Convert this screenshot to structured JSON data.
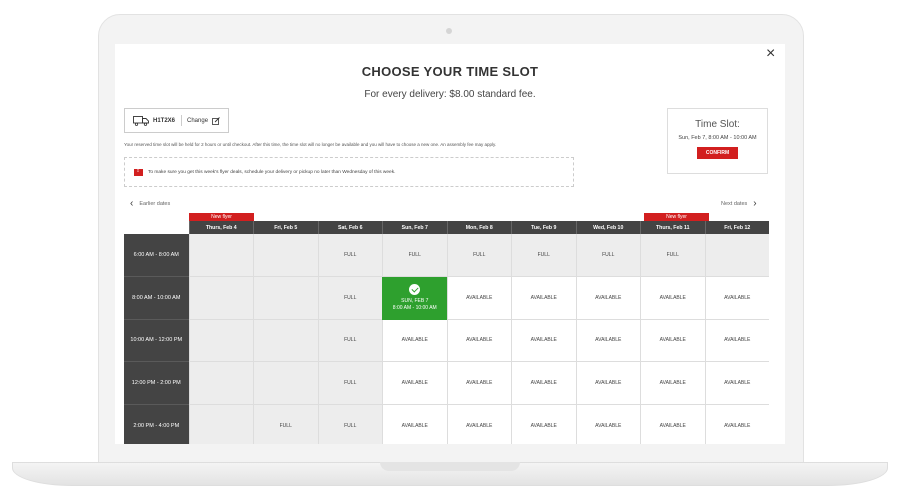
{
  "modal": {
    "close_label": "×",
    "title": "CHOOSE YOUR TIME SLOT",
    "subtitle": "For every delivery: $8.00 standard fee."
  },
  "postal": {
    "code": "H1T2X6",
    "change_label": "Change",
    "icon": "truck-icon"
  },
  "info_text": "Your reserved time slot will be held for 2 hours or until checkout. After this time, the time slot will no longer be available and you will have to choose a new one. An assembly fee may apply.",
  "flyer_notice": "To make sure you get this week's flyer deals, schedule your delivery or pickup no later than Wednesday of this week.",
  "timeslot_card": {
    "heading": "Time Slot:",
    "value": "Sun, Feb 7, 8:00 AM - 10:00 AM",
    "confirm_label": "CONFIRM"
  },
  "nav": {
    "earlier_label": "Earlier dates",
    "next_label": "Next dates"
  },
  "flyer_tag_label": "New flyer",
  "days": [
    "Thurs, Feb 4",
    "Fri, Feb 5",
    "Sat, Feb 6",
    "Sun, Feb 7",
    "Mon, Feb 8",
    "Tue, Feb 9",
    "Wed, Feb 10",
    "Thurs, Feb 11",
    "Fri, Feb 12"
  ],
  "times": [
    "6:00 AM - 8:00 AM",
    "8:00 AM - 10:00 AM",
    "10:00 AM - 12:00 PM",
    "12:00 PM - 2:00 PM",
    "2:00 PM - 4:00 PM"
  ],
  "slots": [
    [
      "",
      "",
      "FULL",
      "FULL",
      "FULL",
      "FULL",
      "FULL",
      "FULL",
      ""
    ],
    [
      "",
      "",
      "FULL",
      "SELECTED",
      "AVAILABLE",
      "AVAILABLE",
      "AVAILABLE",
      "AVAILABLE",
      "AVAILABLE"
    ],
    [
      "",
      "",
      "FULL",
      "AVAILABLE",
      "AVAILABLE",
      "AVAILABLE",
      "AVAILABLE",
      "AVAILABLE",
      "AVAILABLE"
    ],
    [
      "",
      "",
      "FULL",
      "AVAILABLE",
      "AVAILABLE",
      "AVAILABLE",
      "AVAILABLE",
      "AVAILABLE",
      "AVAILABLE"
    ],
    [
      "",
      "FULL",
      "FULL",
      "AVAILABLE",
      "AVAILABLE",
      "AVAILABLE",
      "AVAILABLE",
      "AVAILABLE",
      "AVAILABLE"
    ]
  ],
  "selected_slot": {
    "line1": "SUN, FEB 7",
    "line2": "8:00 AM - 10:00 AM"
  },
  "colors": {
    "accent_red": "#d21f1f",
    "selected_green": "#2ea02e",
    "header_dark": "#444444"
  }
}
